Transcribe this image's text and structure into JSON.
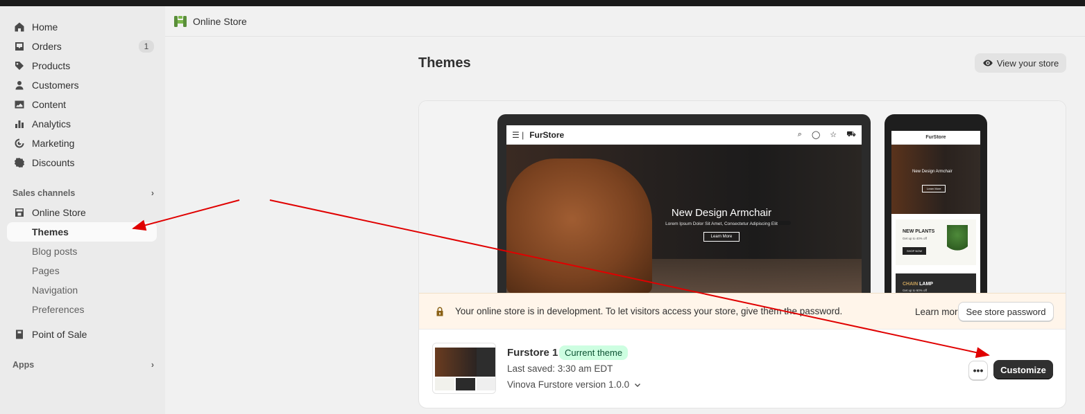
{
  "sidebar": {
    "items": [
      {
        "label": "Home",
        "icon": "home-icon"
      },
      {
        "label": "Orders",
        "icon": "inbox-icon",
        "badge": "1"
      },
      {
        "label": "Products",
        "icon": "tag-icon"
      },
      {
        "label": "Customers",
        "icon": "person-icon"
      },
      {
        "label": "Content",
        "icon": "image-icon"
      },
      {
        "label": "Analytics",
        "icon": "bar-chart-icon"
      },
      {
        "label": "Marketing",
        "icon": "target-icon"
      },
      {
        "label": "Discounts",
        "icon": "discount-icon"
      }
    ],
    "sales_channels_title": "Sales channels",
    "online_store": "Online Store",
    "sub_items": [
      "Themes",
      "Blog posts",
      "Pages",
      "Navigation",
      "Preferences"
    ],
    "point_of_sale": "Point of Sale",
    "apps_title": "Apps"
  },
  "header": {
    "title": "Online Store"
  },
  "page": {
    "title": "Themes",
    "view_store": "View your store"
  },
  "preview": {
    "brand": "FurStore",
    "hero_title": "New Design Armchair",
    "hero_sub": "Lorem Ipsum Dolor Sit Amet, Consectetur Adipiscing Elit",
    "hero_button": "Learn More",
    "mobile_hero_title": "New Design Armchair",
    "mobile_hero_button": "Learn More",
    "card1_title": "NEW PLANTS",
    "card1_sub": "Get up to 40% off",
    "card1_button": "SHOP NOW",
    "card2_title_a": "CHAIN",
    "card2_title_b": "LAMP",
    "card2_sub": "Get up to 60% off"
  },
  "banner": {
    "text": "Your online store is in development. To let visitors access your store, give them the password.",
    "learn_more": "Learn more",
    "see_password": "See store password"
  },
  "theme": {
    "name": "Furstore 1",
    "badge": "Current theme",
    "last_saved": "Last saved: 3:30 am EDT",
    "version": "Vinova Furstore version 1.0.0",
    "more": "•••",
    "customize": "Customize"
  },
  "colors": {
    "annotation_arrow": "#e00000",
    "accent_dark": "#303030",
    "badge_green": "#cdfee1"
  }
}
